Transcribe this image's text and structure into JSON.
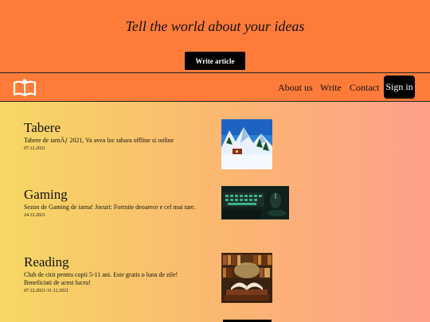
{
  "hero": {
    "title": "Tell the world about your ideas",
    "button_label": "Write article"
  },
  "nav": {
    "logo_icon": "open-book-icon",
    "links": [
      "About us",
      "Write",
      "Contact"
    ],
    "signin_label": "Sign in"
  },
  "articles": [
    {
      "title": "Tabere",
      "description": "Tabere de iarnÄƒ 2021, Va avea loc tabara offline si online",
      "date": "07.12.2021",
      "image": "snowy-mountain-cabin-image"
    },
    {
      "title": "Gaming",
      "description": "Sezon de Gaming de iarna! Jocuri: Fortnite deoarece e cel mai tare.",
      "date": "24.12.2021",
      "image": "gaming-keyboard-mouse-image"
    },
    {
      "title": "Reading",
      "description": "Club de citit pentru copii 5-11 ani. Este gratis o luna de zile! Beneficiati de acest lucru!",
      "date": "07.12.2021-31.12.2021",
      "image": "open-books-library-image"
    }
  ],
  "colors": {
    "header_orange": "#ff7b3a",
    "gradient_left": "#f6d864",
    "gradient_right": "#fda08a"
  }
}
